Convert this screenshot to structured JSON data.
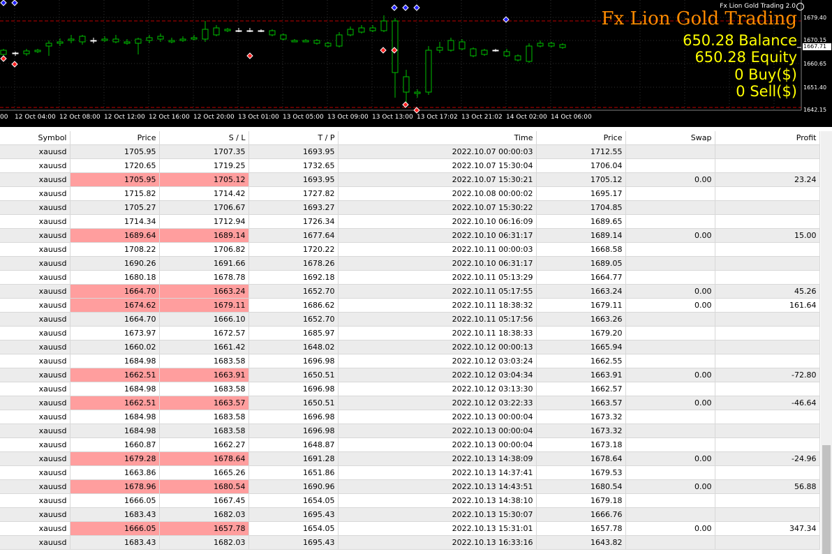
{
  "chart": {
    "indicator_label": "Fx Lion Gold Trading 2.0",
    "title": "Fx Lion Gold Trading",
    "balance_text": "650.28 Balance",
    "equity_text": "650.28 Equity",
    "buy_text": "0 Buy($)",
    "sell_text": "0 Sell($)",
    "current_price": "1667.71",
    "price_ticks": [
      "1679.40",
      "1670.15",
      "1660.65",
      "1651.40",
      "1642.15"
    ],
    "time_ticks": [
      "00",
      "12 Oct 04:00",
      "12 Oct 08:00",
      "12 Oct 12:00",
      "12 Oct 16:00",
      "12 Oct 20:00",
      "13 Oct 01:00",
      "13 Oct 05:00",
      "13 Oct 09:00",
      "13 Oct 13:00",
      "13 Oct 17:02",
      "13 Oct 21:02",
      "14 Oct 02:00",
      "14 Oct 06:00"
    ],
    "colors": {
      "background": "#000000",
      "title": "#ff8c00",
      "stats": "#ffff00",
      "bull": "#00c000",
      "bear": "#ffffff",
      "level": "#c00000",
      "grid": "#303030"
    }
  },
  "table": {
    "columns": [
      "Symbol",
      "Price",
      "S / L",
      "T / P",
      "Time",
      "Price",
      "Swap",
      "Profit"
    ],
    "rows": [
      {
        "symbol": "xauusd",
        "price": "1705.95",
        "sl": "1707.35",
        "tp": "1693.95",
        "time": "2022.10.07 00:00:03",
        "close": "1712.55",
        "swap": "",
        "profit": "",
        "hit": false
      },
      {
        "symbol": "xauusd",
        "price": "1720.65",
        "sl": "1719.25",
        "tp": "1732.65",
        "time": "2022.10.07 15:30:04",
        "close": "1706.04",
        "swap": "",
        "profit": "",
        "hit": false
      },
      {
        "symbol": "xauusd",
        "price": "1705.95",
        "sl": "1705.12",
        "tp": "1693.95",
        "time": "2022.10.07 15:30:21",
        "close": "1705.12",
        "swap": "0.00",
        "profit": "23.24",
        "hit": true
      },
      {
        "symbol": "xauusd",
        "price": "1715.82",
        "sl": "1714.42",
        "tp": "1727.82",
        "time": "2022.10.08 00:00:02",
        "close": "1695.17",
        "swap": "",
        "profit": "",
        "hit": false
      },
      {
        "symbol": "xauusd",
        "price": "1705.27",
        "sl": "1706.67",
        "tp": "1693.27",
        "time": "2022.10.07 15:30:22",
        "close": "1704.85",
        "swap": "",
        "profit": "",
        "hit": false
      },
      {
        "symbol": "xauusd",
        "price": "1714.34",
        "sl": "1712.94",
        "tp": "1726.34",
        "time": "2022.10.10 06:16:09",
        "close": "1689.65",
        "swap": "",
        "profit": "",
        "hit": false
      },
      {
        "symbol": "xauusd",
        "price": "1689.64",
        "sl": "1689.14",
        "tp": "1677.64",
        "time": "2022.10.10 06:31:17",
        "close": "1689.14",
        "swap": "0.00",
        "profit": "15.00",
        "hit": true
      },
      {
        "symbol": "xauusd",
        "price": "1708.22",
        "sl": "1706.82",
        "tp": "1720.22",
        "time": "2022.10.11 00:00:03",
        "close": "1668.58",
        "swap": "",
        "profit": "",
        "hit": false
      },
      {
        "symbol": "xauusd",
        "price": "1690.26",
        "sl": "1691.66",
        "tp": "1678.26",
        "time": "2022.10.10 06:31:17",
        "close": "1689.05",
        "swap": "",
        "profit": "",
        "hit": false
      },
      {
        "symbol": "xauusd",
        "price": "1680.18",
        "sl": "1678.78",
        "tp": "1692.18",
        "time": "2022.10.11 05:13:29",
        "close": "1664.77",
        "swap": "",
        "profit": "",
        "hit": false
      },
      {
        "symbol": "xauusd",
        "price": "1664.70",
        "sl": "1663.24",
        "tp": "1652.70",
        "time": "2022.10.11 05:17:55",
        "close": "1663.24",
        "swap": "0.00",
        "profit": "45.26",
        "hit": true
      },
      {
        "symbol": "xauusd",
        "price": "1674.62",
        "sl": "1679.11",
        "tp": "1686.62",
        "time": "2022.10.11 18:38:32",
        "close": "1679.11",
        "swap": "0.00",
        "profit": "161.64",
        "hit": true
      },
      {
        "symbol": "xauusd",
        "price": "1664.70",
        "sl": "1666.10",
        "tp": "1652.70",
        "time": "2022.10.11 05:17:56",
        "close": "1663.26",
        "swap": "",
        "profit": "",
        "hit": false
      },
      {
        "symbol": "xauusd",
        "price": "1673.97",
        "sl": "1672.57",
        "tp": "1685.97",
        "time": "2022.10.11 18:38:33",
        "close": "1679.20",
        "swap": "",
        "profit": "",
        "hit": false
      },
      {
        "symbol": "xauusd",
        "price": "1660.02",
        "sl": "1661.42",
        "tp": "1648.02",
        "time": "2022.10.12 00:00:13",
        "close": "1665.94",
        "swap": "",
        "profit": "",
        "hit": false
      },
      {
        "symbol": "xauusd",
        "price": "1684.98",
        "sl": "1683.58",
        "tp": "1696.98",
        "time": "2022.10.12 03:03:24",
        "close": "1662.55",
        "swap": "",
        "profit": "",
        "hit": false
      },
      {
        "symbol": "xauusd",
        "price": "1662.51",
        "sl": "1663.91",
        "tp": "1650.51",
        "time": "2022.10.12 03:04:34",
        "close": "1663.91",
        "swap": "0.00",
        "profit": "-72.80",
        "hit": true
      },
      {
        "symbol": "xauusd",
        "price": "1684.98",
        "sl": "1683.58",
        "tp": "1696.98",
        "time": "2022.10.12 03:13:30",
        "close": "1662.57",
        "swap": "",
        "profit": "",
        "hit": false
      },
      {
        "symbol": "xauusd",
        "price": "1662.51",
        "sl": "1663.57",
        "tp": "1650.51",
        "time": "2022.10.12 03:22:33",
        "close": "1663.57",
        "swap": "0.00",
        "profit": "-46.64",
        "hit": true
      },
      {
        "symbol": "xauusd",
        "price": "1684.98",
        "sl": "1683.58",
        "tp": "1696.98",
        "time": "2022.10.13 00:00:04",
        "close": "1673.32",
        "swap": "",
        "profit": "",
        "hit": false
      },
      {
        "symbol": "xauusd",
        "price": "1684.98",
        "sl": "1683.58",
        "tp": "1696.98",
        "time": "2022.10.13 00:00:04",
        "close": "1673.32",
        "swap": "",
        "profit": "",
        "hit": false
      },
      {
        "symbol": "xauusd",
        "price": "1660.87",
        "sl": "1662.27",
        "tp": "1648.87",
        "time": "2022.10.13 00:00:04",
        "close": "1673.18",
        "swap": "",
        "profit": "",
        "hit": false
      },
      {
        "symbol": "xauusd",
        "price": "1679.28",
        "sl": "1678.64",
        "tp": "1691.28",
        "time": "2022.10.13 14:38:09",
        "close": "1678.64",
        "swap": "0.00",
        "profit": "-24.96",
        "hit": true
      },
      {
        "symbol": "xauusd",
        "price": "1663.86",
        "sl": "1665.26",
        "tp": "1651.86",
        "time": "2022.10.13 14:37:41",
        "close": "1679.53",
        "swap": "",
        "profit": "",
        "hit": false
      },
      {
        "symbol": "xauusd",
        "price": "1678.96",
        "sl": "1680.54",
        "tp": "1690.96",
        "time": "2022.10.13 14:43:51",
        "close": "1680.54",
        "swap": "0.00",
        "profit": "56.88",
        "hit": true
      },
      {
        "symbol": "xauusd",
        "price": "1666.05",
        "sl": "1667.45",
        "tp": "1654.05",
        "time": "2022.10.13 14:38:10",
        "close": "1679.18",
        "swap": "",
        "profit": "",
        "hit": false
      },
      {
        "symbol": "xauusd",
        "price": "1683.43",
        "sl": "1682.03",
        "tp": "1695.43",
        "time": "2022.10.13 15:30:07",
        "close": "1666.76",
        "swap": "",
        "profit": "",
        "hit": false
      },
      {
        "symbol": "xauusd",
        "price": "1666.05",
        "sl": "1657.78",
        "tp": "1654.05",
        "time": "2022.10.13 15:31:01",
        "close": "1657.78",
        "swap": "0.00",
        "profit": "347.34",
        "hit": true
      },
      {
        "symbol": "xauusd",
        "price": "1683.43",
        "sl": "1682.03",
        "tp": "1695.43",
        "time": "2022.10.13 16:33:16",
        "close": "1643.82",
        "swap": "",
        "profit": "",
        "hit": false
      }
    ]
  }
}
